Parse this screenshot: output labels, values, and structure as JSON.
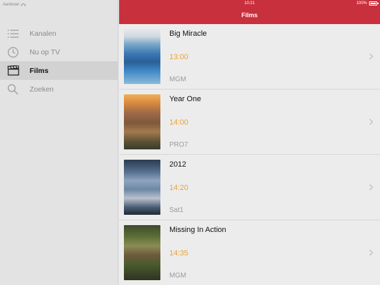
{
  "status": {
    "carrier": "Aardvoer",
    "time": "10:21",
    "battery": "100%"
  },
  "header": {
    "title": "Films"
  },
  "sidebar": {
    "items": [
      {
        "label": "Kanalen",
        "icon": "list-icon",
        "active": false
      },
      {
        "label": "Nu op TV",
        "icon": "clock-icon",
        "active": false
      },
      {
        "label": "Films",
        "icon": "clapperboard-icon",
        "active": true
      },
      {
        "label": "Zoeken",
        "icon": "search-icon",
        "active": false
      }
    ]
  },
  "movies": [
    {
      "title": "Big Miracle",
      "time": "13:00",
      "channel": "MGM"
    },
    {
      "title": "Year One",
      "time": "14:00",
      "channel": "PRO7"
    },
    {
      "title": "2012",
      "time": "14:20",
      "channel": "Sat1"
    },
    {
      "title": "Missing In Action",
      "time": "14:35",
      "channel": "MGM"
    }
  ],
  "colors": {
    "accent": "#c8303d",
    "time": "#e9a23b"
  }
}
